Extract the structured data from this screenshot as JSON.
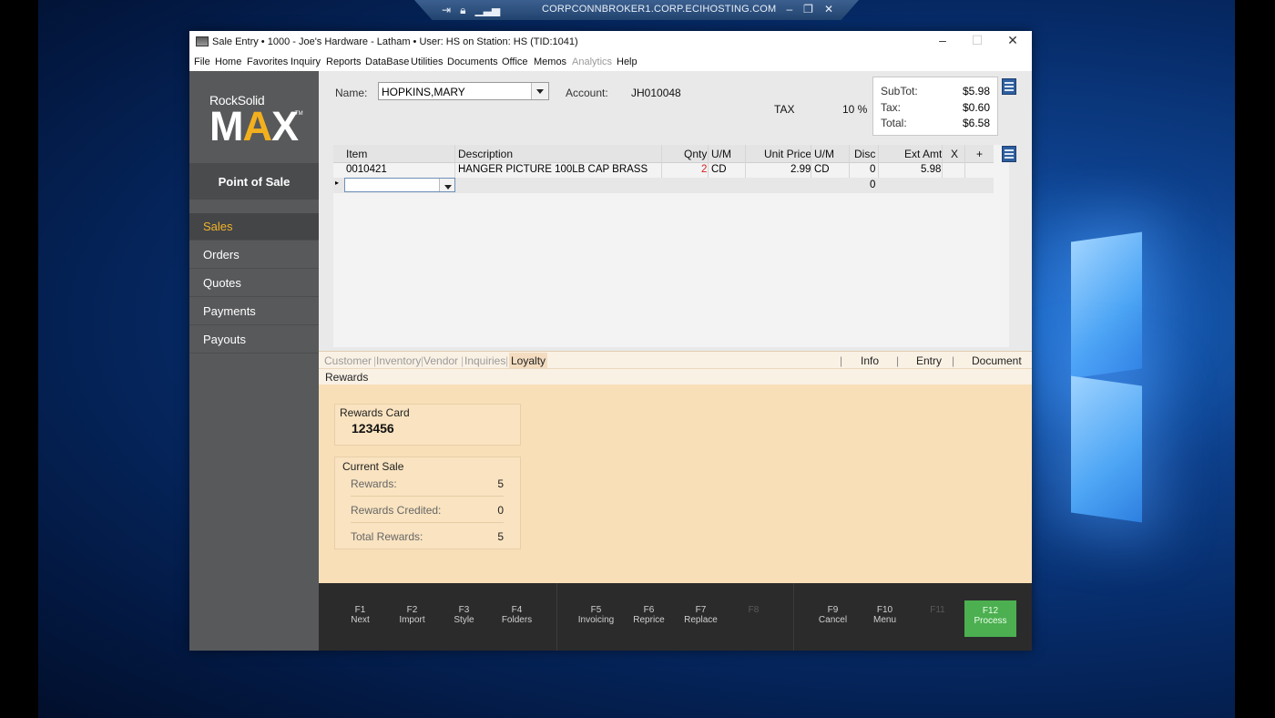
{
  "remote": {
    "host": "CORPCONNBROKER1.CORP.ECIHOSTING.COM"
  },
  "window": {
    "title": "Sale Entry  •  1000 - Joe's Hardware - Latham  •  User: HS on Station: HS (TID:1041)"
  },
  "menu": [
    "File",
    "Home",
    "Favorites",
    "Inquiry",
    "Reports",
    "DataBase",
    "Utilities",
    "Documents",
    "Office",
    "Memos",
    "Analytics",
    "Help"
  ],
  "brand": {
    "small": "RockSolid",
    "big_m": "M",
    "big_a": "A",
    "big_x": "X",
    "tm": "TM",
    "module": "Point of Sale"
  },
  "nav": [
    "Sales",
    "Orders",
    "Quotes",
    "Payments",
    "Payouts"
  ],
  "header": {
    "name_label": "Name:",
    "name_value": "HOPKINS,MARY",
    "account_label": "Account:",
    "account_value": "JH010048",
    "tax_label": "TAX",
    "tax_rate": "10 %"
  },
  "totals": {
    "subtot_label": "SubTot:",
    "subtot": "$5.98",
    "tax_label": "Tax:",
    "tax": "$0.60",
    "total_label": "Total:",
    "total": "$6.58"
  },
  "grid": {
    "columns": [
      "Item",
      "Description",
      "Qnty",
      "U/M",
      "Unit Price",
      "U/M",
      "Disc",
      "Ext Amt",
      "X",
      "+"
    ],
    "rows": [
      {
        "item": "0010421",
        "description": "HANGER PICTURE 100LB CAP BRASS",
        "qnty": "2",
        "um": "CD",
        "unit_price": "2.99",
        "um2": "CD",
        "disc": "0",
        "ext": "5.98"
      }
    ],
    "new_row_disc": "0"
  },
  "tabs": [
    "Customer",
    "Inventory",
    "Vendor",
    "Inquiries",
    "Loyalty"
  ],
  "right_tabs": [
    "Info",
    "Entry",
    "Document"
  ],
  "subtab": "Rewards",
  "rewards_card": {
    "legend": "Rewards Card",
    "number": "123456"
  },
  "current_sale": {
    "legend": "Current Sale",
    "rows": [
      {
        "label": "Rewards:",
        "value": "5"
      },
      {
        "label": "Rewards Credited:",
        "value": "0"
      },
      {
        "label": "Total Rewards:",
        "value": "5"
      }
    ]
  },
  "fkeys": [
    {
      "key": "F1",
      "label": "Next"
    },
    {
      "key": "F2",
      "label": "Import"
    },
    {
      "key": "F3",
      "label": "Style"
    },
    {
      "key": "F4",
      "label": "Folders"
    },
    {
      "key": "F5",
      "label": "Invoicing"
    },
    {
      "key": "F6",
      "label": "Reprice"
    },
    {
      "key": "F7",
      "label": "Replace"
    },
    {
      "key": "F8",
      "label": ""
    },
    {
      "key": "F9",
      "label": "Cancel"
    },
    {
      "key": "F10",
      "label": "Menu"
    },
    {
      "key": "F11",
      "label": ""
    },
    {
      "key": "F12",
      "label": "Process"
    }
  ],
  "colors": {
    "accent": "#f0b429",
    "process": "#4caf50",
    "sidebar": "#58595b",
    "panel": "#f8dfb8"
  }
}
